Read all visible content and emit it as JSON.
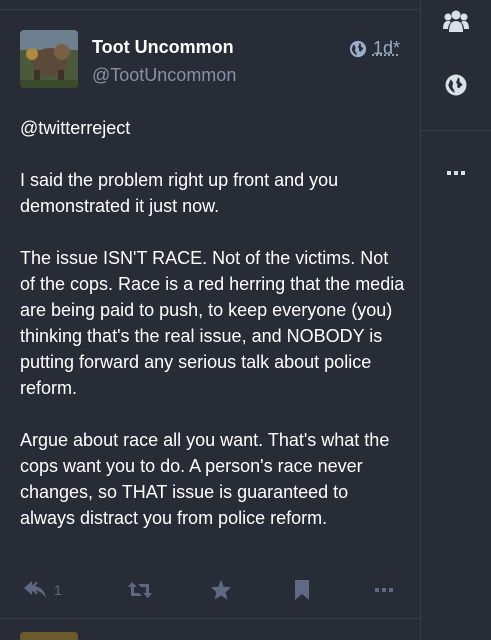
{
  "status": {
    "display_name": "Toot Uncommon",
    "account": "@TootUncommon",
    "visibility_icon": "globe-icon",
    "time": "1d",
    "time_suffix": "*",
    "mention": "@twitterreject",
    "paragraphs": [
      "I said the problem right up front and you demonstrated it just now.",
      "The issue ISN'T RACE. Not of the victims. Not of the cops. Race is a red herring that the media are being paid to push, to keep everyone (you) thinking that's the real issue, and NOBODY is putting forward any serious talk about police reform.",
      "Argue about race all you want. That's what the cops want you to do. A person's race never changes, so THAT issue is guaranteed to always distract you from police reform."
    ],
    "actions": {
      "reply_count": "1",
      "reply_icon": "reply-all-icon",
      "boost_icon": "boost-icon",
      "favourite_icon": "star-icon",
      "bookmark_icon": "bookmark-icon",
      "more_icon": "ellipsis-icon"
    }
  },
  "sidebar": {
    "items": [
      {
        "icon": "users-icon"
      },
      {
        "icon": "globe-icon"
      },
      {
        "icon": "ellipsis-icon"
      }
    ]
  },
  "colors": {
    "background": "#282c37",
    "divider": "#393f4f",
    "muted": "#8a91a6",
    "action": "#606984",
    "meta": "#9baec8"
  }
}
